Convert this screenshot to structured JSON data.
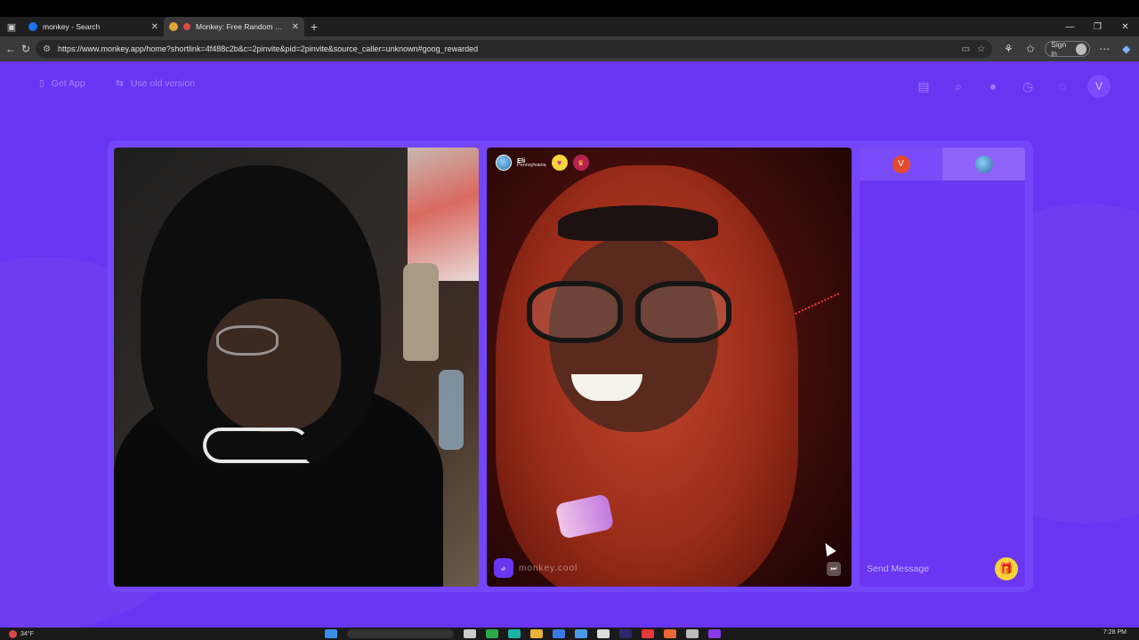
{
  "browser": {
    "tabs": [
      {
        "title": "monkey - Search",
        "active": false,
        "favicon": "search-icon"
      },
      {
        "title": "Monkey: Free Random Video Chat",
        "active": true,
        "favicon": "monkey-icon"
      }
    ],
    "url": "https://www.monkey.app/home?shortlink=4f488c2b&c=2pinvite&pid=2pinvite&source_caller=unknown#goog_rewarded",
    "sign_in_label": "Sign in"
  },
  "page": {
    "get_app_label": "Get App",
    "old_version_label": "Use old version",
    "user_initial": "V",
    "accent_color": "#6a35f2"
  },
  "peer": {
    "name": "Eli",
    "location": "Pennsylvania"
  },
  "watermark": "monkey.cool",
  "chat": {
    "self_initial": "V",
    "input_placeholder": "Send Message"
  },
  "taskbar": {
    "temperature": "34°F",
    "time": "7:28 PM"
  }
}
